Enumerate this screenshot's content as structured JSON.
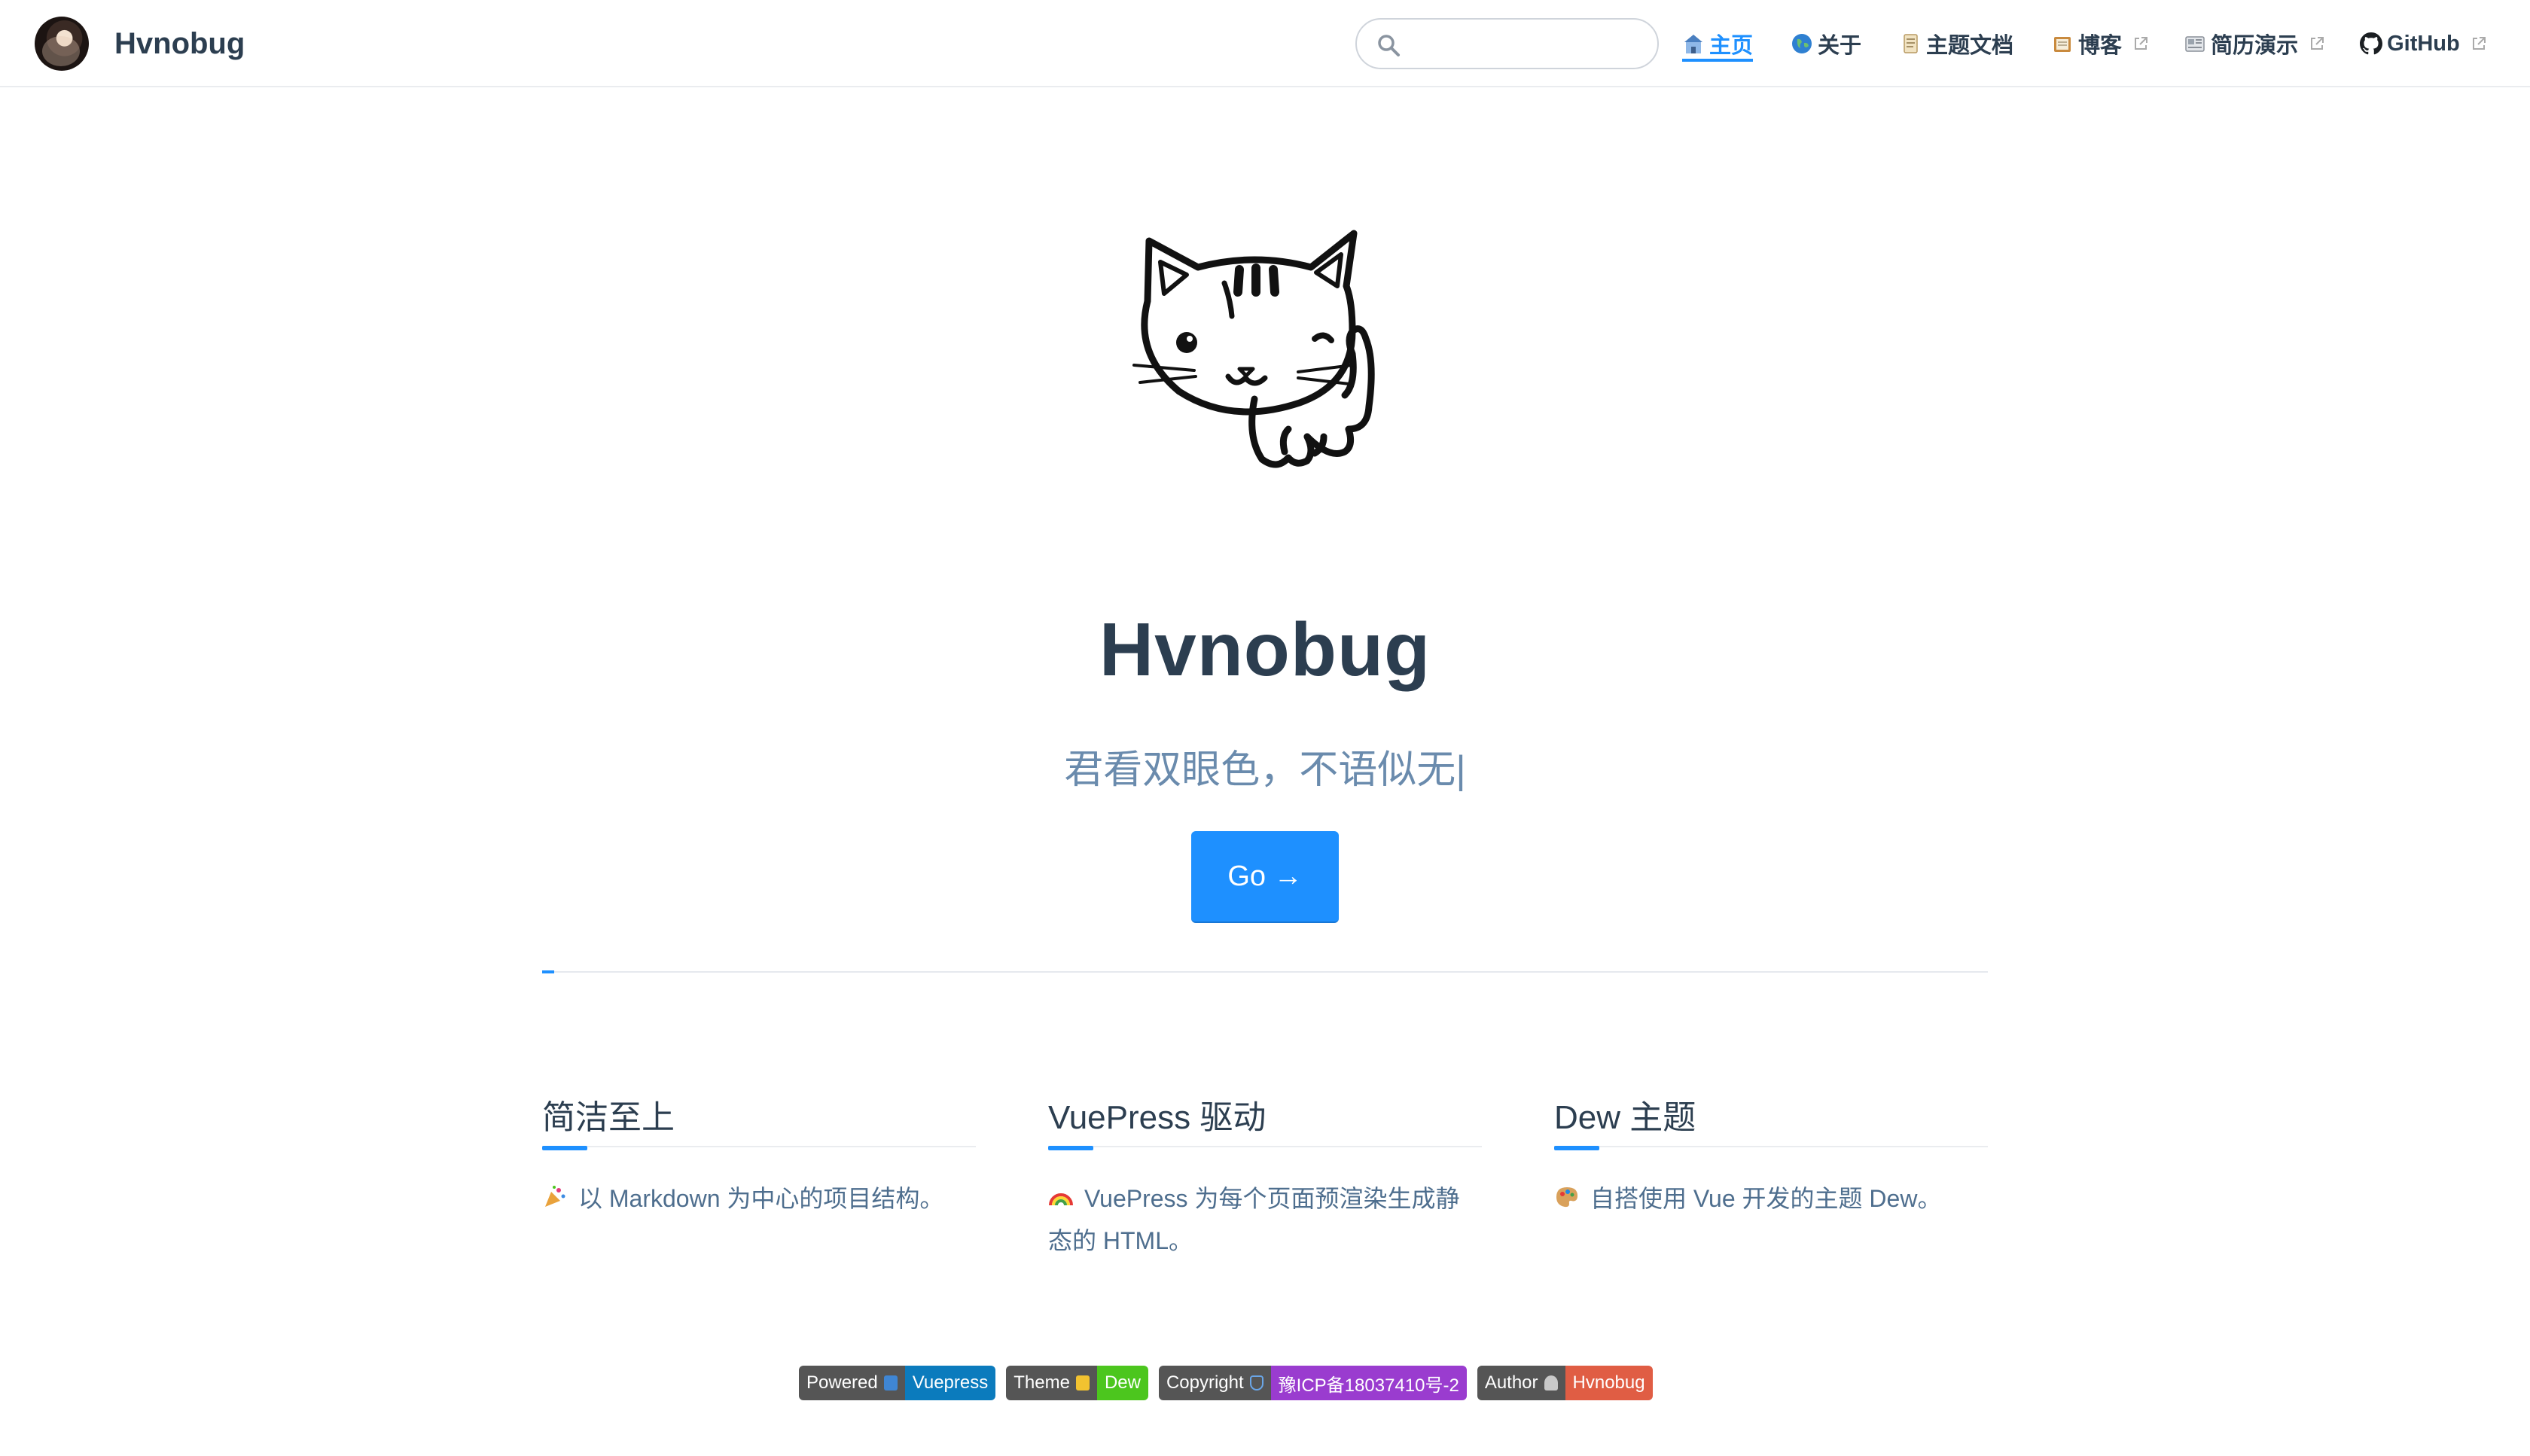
{
  "brand": {
    "name": "Hvnobug"
  },
  "search": {
    "value": "",
    "placeholder": ""
  },
  "nav": {
    "items": [
      {
        "label": "主页",
        "icon": "house-icon",
        "active": true
      },
      {
        "label": "关于",
        "icon": "globe-icon"
      },
      {
        "label": "主题文档",
        "icon": "scroll-icon"
      },
      {
        "label": "博客",
        "icon": "notebook-icon",
        "external": true
      },
      {
        "label": "简历演示",
        "icon": "newspaper-icon",
        "external": true
      },
      {
        "label": "GitHub",
        "icon": "github-icon",
        "external": true
      }
    ]
  },
  "hero": {
    "title": "Hvnobug",
    "description": "君看双眼色，不语似无",
    "caret": "|",
    "action_label": "Go →"
  },
  "features": [
    {
      "title": "简洁至上",
      "icon": "party-popper-icon",
      "text": "以 Markdown 为中心的项目结构。"
    },
    {
      "title": "VuePress 驱动",
      "icon": "rainbow-icon",
      "text": "VuePress 为每个页面预渲染生成静态的 HTML。"
    },
    {
      "title": "Dew 主题",
      "icon": "palette-icon",
      "text": "自搭使用 Vue 开发的主题 Dew。"
    }
  ],
  "badges": [
    {
      "left": "Powered",
      "right": "Vuepress",
      "color": "#0b7bbd"
    },
    {
      "left": "Theme",
      "right": "Dew",
      "color": "#4cc61e"
    },
    {
      "left": "Copyright",
      "right": "豫ICP备18037410号-2",
      "color": "#9a3ccf"
    },
    {
      "left": "Author",
      "right": "Hvnobug",
      "color": "#e05d44"
    }
  ],
  "colors": {
    "accent": "#1e90ff",
    "text": "#2c3e50",
    "muted": "#6a8bad"
  }
}
